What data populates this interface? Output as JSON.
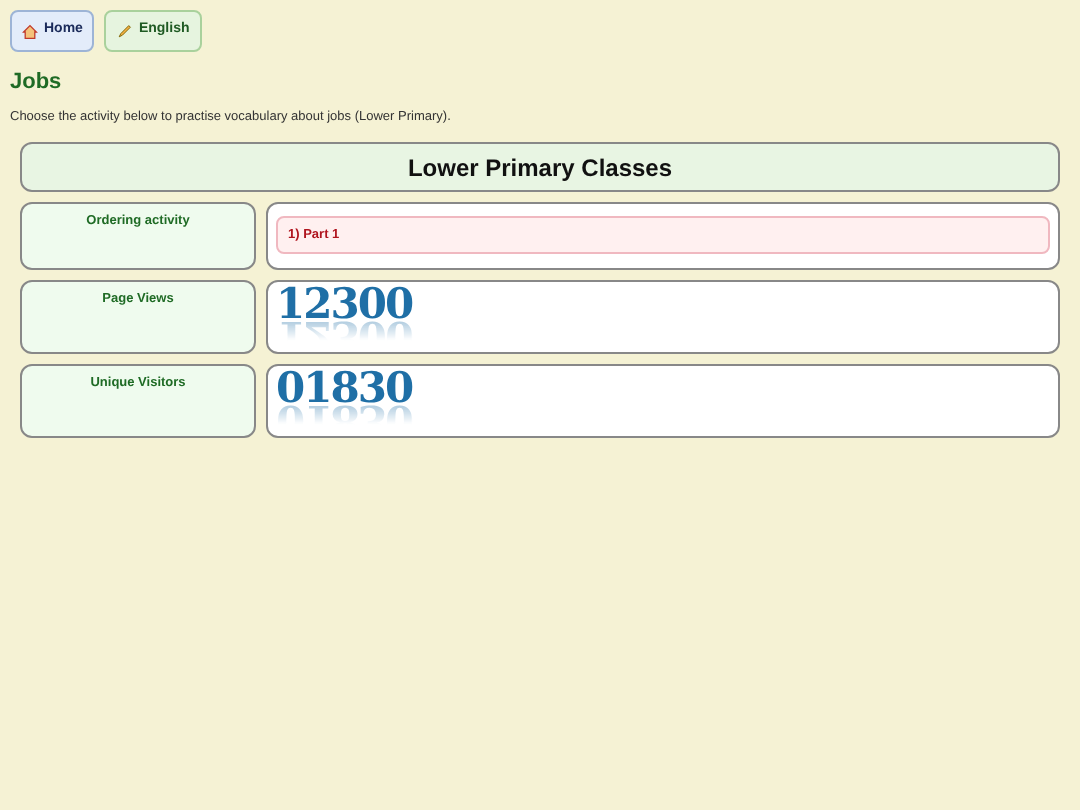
{
  "nav": [
    {
      "label": "Home",
      "kind": "home"
    },
    {
      "label": "English",
      "kind": "subject"
    }
  ],
  "title": "Jobs",
  "intro": "Choose the activity below to practise vocabulary about jobs (Lower Primary).",
  "section": {
    "heading": "Lower Primary Classes",
    "rows": [
      {
        "label": "Ordering activity",
        "kind": "links",
        "links": [
          "1) Part 1"
        ]
      },
      {
        "label": "Page Views",
        "kind": "counter",
        "value": "12300"
      },
      {
        "label": "Unique Visitors",
        "kind": "counter",
        "value": "01830"
      }
    ]
  }
}
